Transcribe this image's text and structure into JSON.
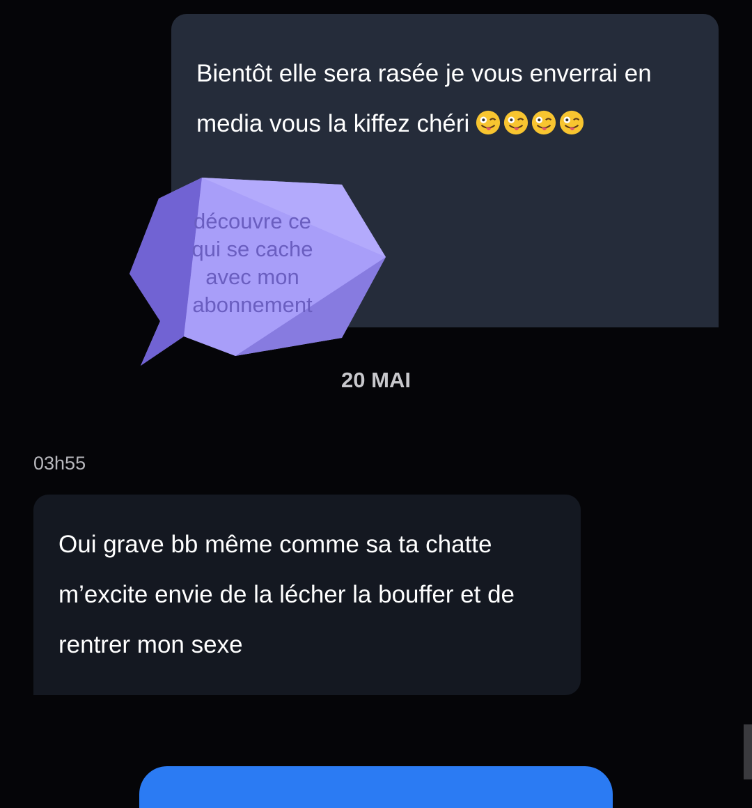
{
  "messages": {
    "outgoing": {
      "text": "Bientôt elle sera rasée je vous enverrai en media vous la kiffez chéri",
      "emojis": [
        "winking-face-with-tongue",
        "winking-face-with-tongue",
        "winking-face-with-tongue",
        "winking-face-with-tongue"
      ],
      "bubble_color": "#252c3a"
    },
    "promo_overlay": {
      "line1": "découvre ce",
      "line2": "qui se cache",
      "line3": "avec mon",
      "line4": "abonnement",
      "color": "#a79cf9",
      "text_color": "#6a5ec0"
    },
    "date_separator": "20 MAI",
    "incoming": {
      "time": "03h55",
      "text": "Oui grave bb même comme sa ta chatte m’excite envie de la lécher la bouffer et de rentrer mon sexe",
      "bubble_color": "#141821"
    }
  },
  "colors": {
    "background": "#050508",
    "accent_button": "#2b7bf3"
  }
}
